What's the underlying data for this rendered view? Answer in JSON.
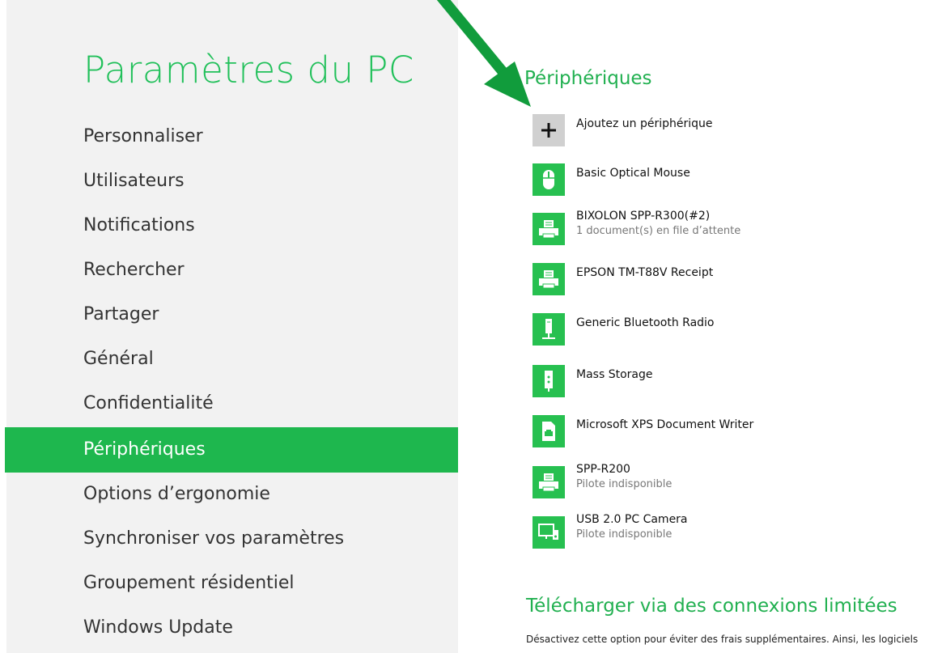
{
  "app_title": "Paramètres du PC",
  "nav": {
    "items": [
      {
        "label": "Personnaliser"
      },
      {
        "label": "Utilisateurs"
      },
      {
        "label": "Notifications"
      },
      {
        "label": "Rechercher"
      },
      {
        "label": "Partager"
      },
      {
        "label": "Général"
      },
      {
        "label": "Confidentialité"
      },
      {
        "label": "Périphériques"
      },
      {
        "label": "Options d’ergonomie"
      },
      {
        "label": "Synchroniser vos paramètres"
      },
      {
        "label": "Groupement résidentiel"
      },
      {
        "label": "Windows Update"
      }
    ],
    "selected": "Périphériques"
  },
  "devices_section": {
    "title": "Périphériques",
    "add_label": "Ajoutez un périphérique",
    "devices": [
      {
        "name": "Basic Optical Mouse",
        "status": "",
        "icon": "mouse-icon"
      },
      {
        "name": "BIXOLON SPP-R300(#2)",
        "status": "1 document(s) en file d’attente",
        "icon": "printer-icon"
      },
      {
        "name": "EPSON TM-T88V Receipt",
        "status": "",
        "icon": "printer-icon"
      },
      {
        "name": "Generic Bluetooth Radio",
        "status": "",
        "icon": "bluetooth-radio-icon"
      },
      {
        "name": "Mass Storage",
        "status": "",
        "icon": "usb-storage-icon"
      },
      {
        "name": "Microsoft XPS Document Writer",
        "status": "",
        "icon": "document-printer-icon"
      },
      {
        "name": "SPP-R200",
        "status": "Pilote indisponible",
        "icon": "printer-icon"
      },
      {
        "name": "USB 2.0 PC Camera",
        "status": "Pilote indisponible",
        "icon": "camera-icon"
      }
    ]
  },
  "metered_section": {
    "title": "Télécharger via des connexions limitées",
    "description": "Désactivez cette option pour éviter des frais supplémentaires. Ainsi, les logiciels"
  },
  "colors": {
    "accent": "#1eb74e",
    "title_green": "#21c05a",
    "left_bg": "#f2f2f2",
    "arrow": "#119c3c"
  }
}
